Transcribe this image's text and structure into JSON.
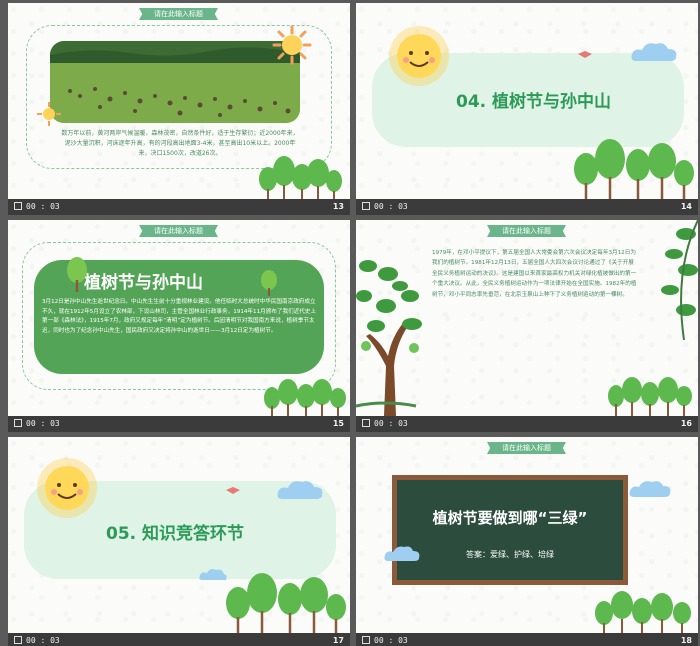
{
  "colors": {
    "accent": "#2e9a58",
    "mint": "#dff4e6",
    "panel": "#54a457",
    "footer": "#3b3b3b"
  },
  "slides": [
    {
      "id": 13,
      "time": "00 : 03",
      "number": "13",
      "tag": "请在此输入标题",
      "paragraph": "数万年以前，黄河两岸气候温暖，森林茂密，自然条件好，适于生存繁衍；近2000年来，泥沙大量沉积，河床逐年升高，有的河段高出地面3-4米，甚至高出10米以上。2000年来，决口1500次，改道26次。",
      "image": "grassland-with-sheep-photo"
    },
    {
      "id": 14,
      "time": "00 : 03",
      "number": "14",
      "title": "04. 植树节与孙中山"
    },
    {
      "id": 15,
      "time": "00 : 03",
      "number": "15",
      "tag": "请在此输入标题",
      "title": "植树节与孙中山",
      "paragraph": "3月12日是孙中山先生逝世纪念日。中山先生生前十分重视林业建设。他任临时大总统时中华民国南京政府成立不久，就在1912年5月设立了农林部，下设山林司，主管全国林业行政事务，1914年11月颁布了我们近代史上第一部《森林法》，1915年7月，政府又规定每年“清明”定为植树节。后因清明节对我国南方来说，植树季节太迟，同时也为了纪念孙中山先生，国民政府又决定将孙中山的逝世日——3月12日定为植树节。"
    },
    {
      "id": 16,
      "time": "00 : 03",
      "number": "16",
      "tag": "请在此输入标题",
      "paragraph": "1979年，在邓小平提议下，第五届全国人大常委会第六次会议决定每年3月12日为我们的植树节。1981年12月13日，五届全国人大四次会议讨论通过了《关于开展全民义务植树运动的决议》。这是建国以来首家最高权力机关对绿化植被做出的第一个重大决议。从此，全民义务植树运动作为一项法律开始在全国实施。1982年的植树节，邓小平同志率先垂范，在北京玉泉山上种下了义务植树运动的第一棵树。"
    },
    {
      "id": 17,
      "time": "00 : 03",
      "number": "17",
      "title": "05. 知识竞答环节"
    },
    {
      "id": 18,
      "time": "00 : 03",
      "number": "18",
      "tag": "请在此输入标题",
      "board_title": "植树节要做到哪“三绿”",
      "board_answer": "答案：爱绿、护绿、培绿"
    }
  ]
}
